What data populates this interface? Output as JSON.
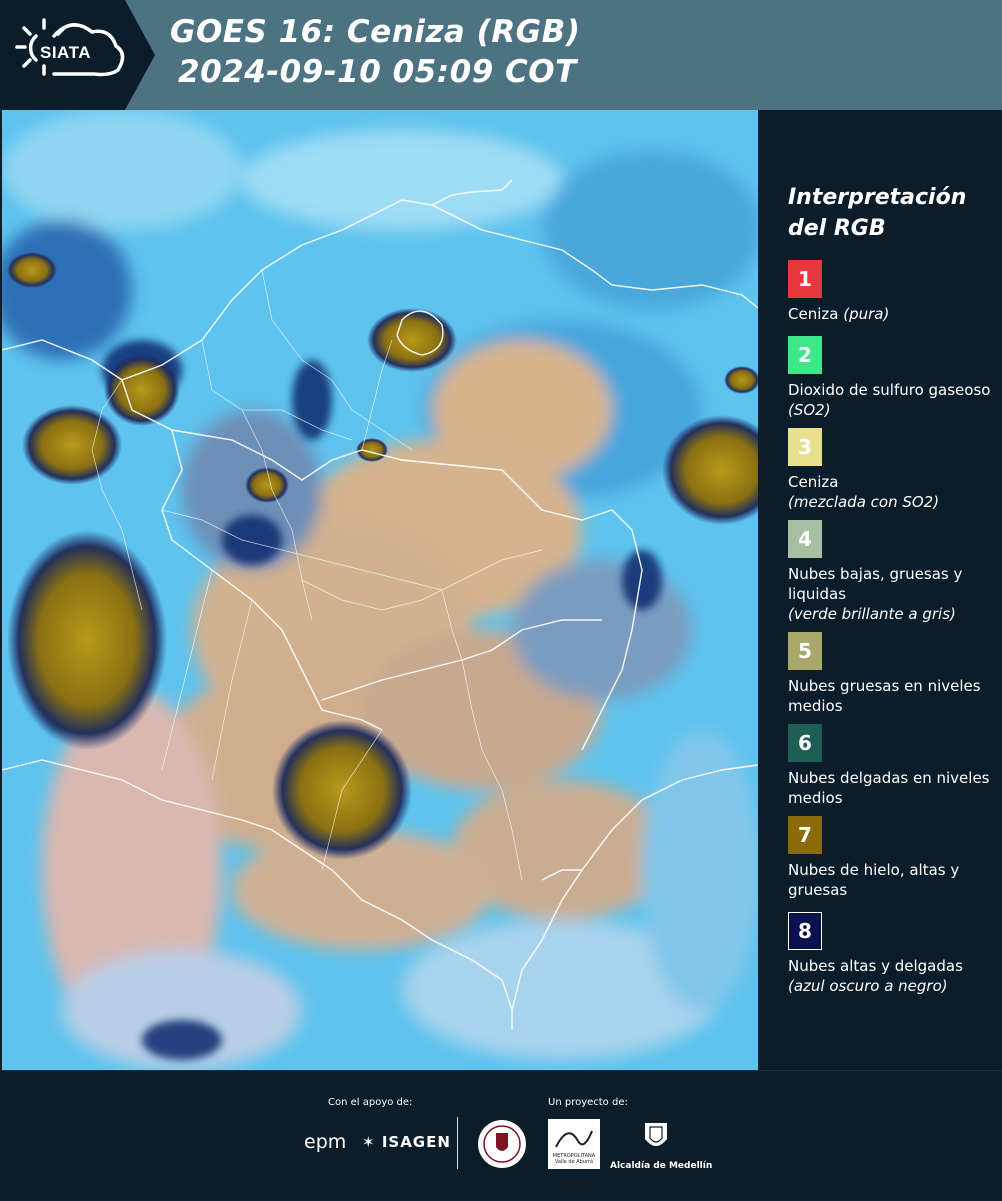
{
  "header": {
    "logo_text": "SIATA",
    "title": "GOES 16: Ceniza (RGB)",
    "datetime": "2024-09-10 05:09 COT"
  },
  "map": {
    "background_color": "#5fc0ea"
  },
  "legend": {
    "title_line1": "Interpretación",
    "title_line2": "del RGB",
    "items": [
      {
        "number": "1",
        "color": "#e8383d",
        "label": "Ceniza",
        "note": "(pura)"
      },
      {
        "number": "2",
        "color": "#3ee88a",
        "label": "Dioxido de sulfuro gaseoso",
        "note": "(SO2)"
      },
      {
        "number": "3",
        "color": "#e8e08a",
        "label": "Ceniza",
        "note": "(mezclada con SO2)"
      },
      {
        "number": "4",
        "color": "#a6bfa3",
        "label": "Nubes bajas, gruesas y liquidas",
        "note": "(verde brillante a gris)"
      },
      {
        "number": "5",
        "color": "#a8a86a",
        "label": "Nubes gruesas en niveles medios",
        "note": ""
      },
      {
        "number": "6",
        "color": "#1e5e55",
        "label": "Nubes delgadas en niveles medios",
        "note": ""
      },
      {
        "number": "7",
        "color": "#8a6a0a",
        "label": "Nubes de hielo, altas y gruesas",
        "note": ""
      },
      {
        "number": "8",
        "color": "#0b1050",
        "label": "Nubes altas y delgadas",
        "note": "(azul oscuro a negro)"
      }
    ]
  },
  "footer": {
    "support_label": "Con el apoyo de:",
    "project_label": "Un proyecto de:",
    "epm": "epm",
    "isagen": "ISAGEN",
    "area_text": "METROPOLITANA Valle de Aburrá",
    "alcaldia": "Alcaldía de Medellín"
  }
}
